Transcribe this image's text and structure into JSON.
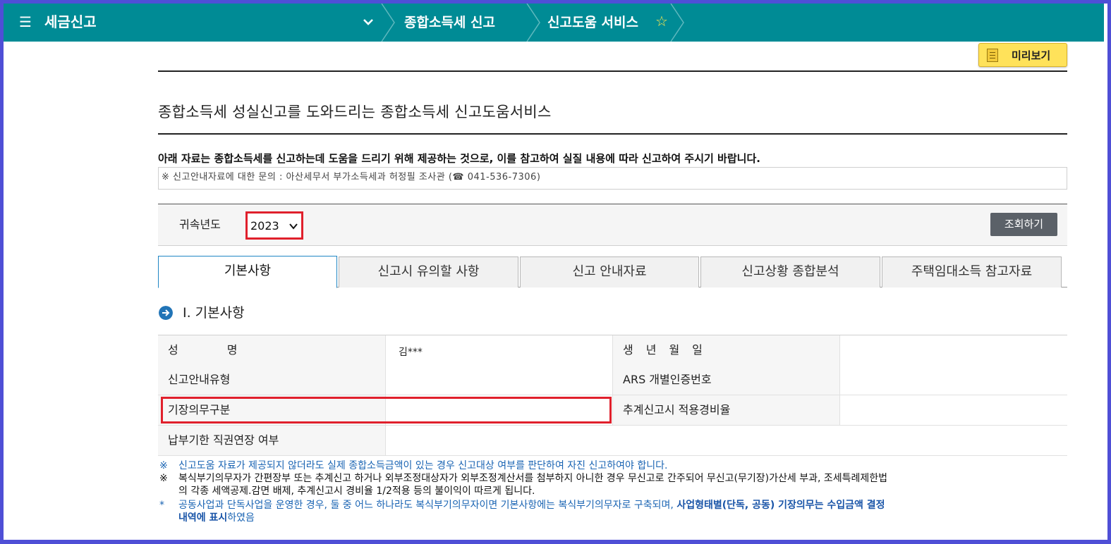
{
  "header": {
    "menu_icon": "hamburger-icon",
    "brand": "세금신고",
    "crumbs": [
      "종합소득세 신고",
      "신고도움 서비스"
    ],
    "favorite_icon": "star-outline-icon",
    "bg_color": "#008b95"
  },
  "preview": {
    "label": "미리보기",
    "icon": "document-icon"
  },
  "page": {
    "title": "종합소득세 성실신고를 도와드리는 종합소득세 신고도움서비스",
    "notice": "아래 자료는 종합소득세를 신고하는데 도움을 드리기 위해 제공하는 것으로, 이를 참고하여 실질 내용에 따라 신고하여 주시기 바랍니다.",
    "inquiry": "※ 신고안내자료에 대한 문의 : 아산세무서 부가소득세과 허정필 조사관 (☎ 041-536-7306)"
  },
  "search": {
    "year_label": "귀속년도",
    "year_value": "2023",
    "button": "조회하기"
  },
  "tabs": [
    {
      "label": "기본사항",
      "active": true
    },
    {
      "label": "신고시 유의할 사항",
      "active": false
    },
    {
      "label": "신고 안내자료",
      "active": false
    },
    {
      "label": "신고상황 종합분석",
      "active": false
    },
    {
      "label": "주택임대소득 참고자료",
      "active": false
    }
  ],
  "section": {
    "title": "Ⅰ. 기본사항",
    "icon": "arrow-circle-icon"
  },
  "table": {
    "name_label": "성　　　　명",
    "name_value": "김***",
    "birth_label": "생　년　월　일",
    "birth_value": "",
    "guide_type_label": "신고안내유형",
    "guide_type_value": "",
    "ars_label": "ARS 개별인증번호",
    "ars_value": "",
    "bookkeeping_label": "기장의무구분",
    "bookkeeping_value": "",
    "expense_rate_label": "추계신고시 적용경비율",
    "expense_rate_value": "",
    "extension_label": "납부기한 직권연장 여부",
    "extension_value": ""
  },
  "notes": {
    "n1_mark": "※",
    "n1": "신고도움 자료가 제공되지 않더라도 실제 종합소득금액이 있는 경우 신고대상 여부를 판단하여 자진 신고하여야 합니다.",
    "n2_mark": "※",
    "n2_line1": "복식부기의무자가 간편장부 또는 추계신고 하거나 외부조정대상자가 외부조정계산서를 첨부하지 아니한 경우 무신고로 간주되어 무신고(무기장)가산세 부과, 조세특례제한법",
    "n2_line2": "의 각종 세액공제.감면 배제, 추계신고시 경비율 1/2적용 등의 불이익이 따르게 됩니다.",
    "n3_mark": "*",
    "n3_a": "공동사업과 단독사업을 운영한 경우, 둘 중 어느 하나라도 복식부기의무자이면 기본사항에는 복식부기의무자로 구축되며, ",
    "n3_b": "사업형태별(단독, 공동) 기장의무는 수입금액 결정",
    "n3_c": "내역에 표시",
    "n3_d": "하였음"
  }
}
